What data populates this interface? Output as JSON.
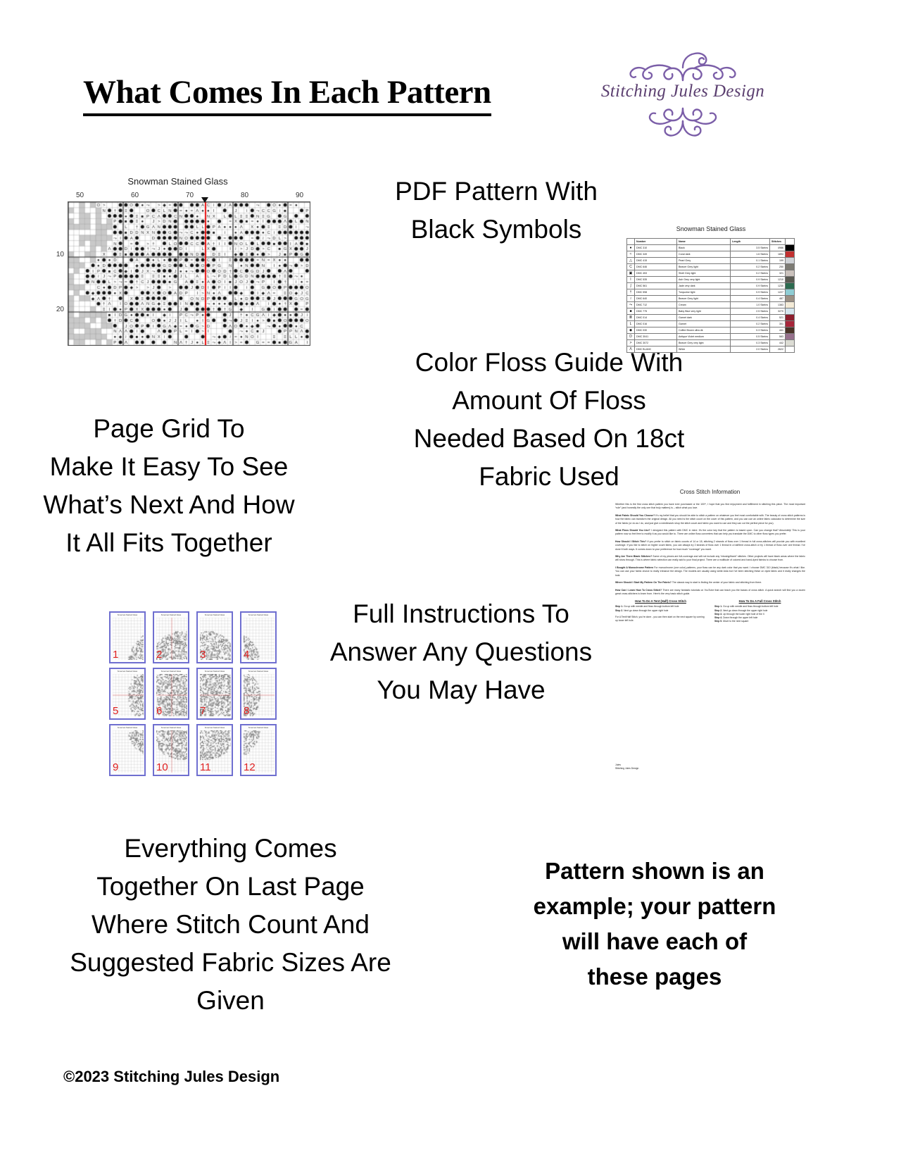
{
  "header": {
    "title": "What Comes In Each Pattern",
    "logo": {
      "brand": "Stitching Jules Design",
      "accent_color": "#7b5ea8",
      "text_color": "#5b3f70",
      "flourish_top_icon": "flourish-ornament-icon",
      "flourish_bottom_icon": "flourish-ornament-icon"
    }
  },
  "captions": {
    "pdf_pattern": "PDF Pattern With\nBlack Symbols",
    "page_grid": "Page Grid To\nMake It Easy To See\nWhat’s Next And How\nIt All Fits Together",
    "color_floss": "Color Floss Guide With\nAmount Of Floss\nNeeded Based On 18ct\nFabric Used",
    "full_instructions": "Full Instructions To\nAnswer Any Questions\nYou May Have",
    "everything_comes": "Everything Comes\nTogether On Last Page\nWhere Stitch Count And\nSuggested Fabric Sizes Are\nGiven",
    "disclaimer": "Pattern shown is an\nexample; your pattern\nwill have each of\nthese pages"
  },
  "footer": {
    "copyright": "©2023 Stitching Jules Design"
  },
  "chart": {
    "title": "Snowman Stained Glass",
    "column_labels": [
      "50",
      "60",
      "70",
      "80",
      "90"
    ],
    "row_labels": [
      "10",
      "20"
    ],
    "center_marker_icon": "center-arrow-icon",
    "center_line_color": "#e81010"
  },
  "floss_guide": {
    "title": "Snowman Stained Glass",
    "columns": [
      "",
      "Number",
      "Name",
      "Length",
      "Stitches",
      ""
    ],
    "rows": [
      {
        "symbol": "●",
        "number": "DMC    310",
        "name": "Black",
        "length": "3.5 Skeins",
        "stitches": "4986",
        "color": "#000000"
      },
      {
        "symbol": "≈",
        "number": "DMC    349",
        "name": "Coral dark",
        "length": "1.6 Skeins",
        "stitches": "1894",
        "color": "#c33030"
      },
      {
        "symbol": "△",
        "number": "DMC    415",
        "name": "Pearl Grey",
        "length": "0.1 Skeins",
        "stitches": "199",
        "color": "#cfd2d6"
      },
      {
        "symbol": "C",
        "number": "DMC    646",
        "name": "Beaver Grey light",
        "length": "0.2 Skeins",
        "stitches": "250",
        "color": "#7d7b74"
      },
      {
        "symbol": "▣",
        "number": "DMC    453",
        "name": "Shell Grey light",
        "length": "0.2 Skeins",
        "stitches": "321",
        "color": "#cbc2bd"
      },
      {
        "symbol": "I",
        "number": "DMC    535",
        "name": "Ash Grey very light",
        "length": "0.9 Skeins",
        "stitches": "1210",
        "color": "#5a5a52"
      },
      {
        "symbol": "∫",
        "number": "DMC    561",
        "name": "Jade very dark",
        "length": "0.9 Skeins",
        "stitches": "1230",
        "color": "#2c6b50"
      },
      {
        "symbol": "†",
        "number": "DMC    598",
        "name": "Turquoise light",
        "length": "0.9 Skeins",
        "stitches": "1227",
        "color": "#8fcdd4"
      },
      {
        "symbol": "≀",
        "number": "DMC    640",
        "name": "Beaver Grey light",
        "length": "0.4 Skeins",
        "stitches": "487",
        "color": "#9b9084"
      },
      {
        "symbol": "⤳",
        "number": "DMC    712",
        "name": "Cream",
        "length": "1.0 Skeins",
        "stitches": "1383",
        "color": "#f3ead6"
      },
      {
        "symbol": "■",
        "number": "DMC    775",
        "name": "Baby Blue very light",
        "length": "2.5 Skeins",
        "stitches": "3270",
        "color": "#d5e6ef"
      },
      {
        "symbol": "≣",
        "number": "DMC    014",
        "name": "Garnet dark",
        "length": "0.4 Skeins",
        "stitches": "521",
        "color": "#8d1f2d"
      },
      {
        "symbol": "L",
        "number": "DMC    016",
        "name": "Garnet",
        "length": "0.2 Skeins",
        "stitches": "301",
        "color": "#a8263a"
      },
      {
        "symbol": "◆",
        "number": "DMC    030",
        "name": "Coffee Brown ultra dk",
        "length": "0.3 Skeins",
        "stitches": "441",
        "color": "#4a3328"
      },
      {
        "symbol": "D",
        "number": "DMC    3041",
        "name": "Antique Violet medium",
        "length": "0.5 Skeins",
        "stitches": "583",
        "color": "#96708c"
      },
      {
        "symbol": ">",
        "number": "DMC    3072",
        "name": "Beaver Grey very light",
        "length": "0.3 Skeins",
        "stitches": "442",
        "color": "#dcdcd4"
      },
      {
        "symbol": "Λ",
        "number": "DMC  BLANC",
        "name": "White",
        "length": "2.0 Skeins",
        "stitches": "2622",
        "color": "#ffffff"
      }
    ]
  },
  "page_grid": {
    "thumbnail_numbers": [
      "1",
      "2",
      "3",
      "4",
      "5",
      "6",
      "7",
      "8",
      "9",
      "10",
      "11",
      "12"
    ],
    "thumbnail_title": "Snowman Stained Glass",
    "border_color": "#6f6fd0",
    "number_color": "#e02020"
  },
  "instructions": {
    "title": "Cross Stitch Information",
    "intro": "Whether this is the first cross stitch pattern you have ever purchased or the 100ᵗʰ, I hope that you find enjoyment and fulfillment in stitching this piece. The most important “rule” (and honestly the only one that truly matters) is – stitch what you love.",
    "sections": [
      {
        "heading": "What Fabric Should You Choose?",
        "body": "It’s my belief that you should be able to stitch a pattern on whatever you feel most comfortable with. The beauty of cross stitch patterns is how the fabric can transform the original design. All you need is the stitch count on the cover of this pattern, and you can use an online fabric calculator to determine the size of the fabric (or do as I do, and just give a needlework shop the stitch count and fabric you want to use and they can cut the perfect piece for you)."
      },
      {
        "heading": "What Floss Should You Use?",
        "body": "I designed this pattern with DMC in mind. It’s the color key that the pattern is based upon. Can you change that? Absolutely! This is your pattern now so feel free to modify it as you would like to. There are online floss converters that can help you translate the DMC to other floss types you prefer."
      },
      {
        "heading": "How Should I Stitch This?",
        "body": "If you prefer to stitch on fabric counts of 14 or 18, stitching 2 strands of floss over 1 thread in full cross-stitches will provide you with excellent coverage. If you like to stitch on higher count fabric, you can always try 2 strands of floss over 1 thread in a half/tent cross-stitch or try 1 thread of floss over one thread. I’ve done it both ways. It comes down to your preference for how much “coverage” you want."
      },
      {
        "heading": "Why Are There Blank Stitches?",
        "body": "Some of my pieces are full-coverage and will not include any “missing/blank” stitches. Other projects will have blank areas where the fabric will show through. This is where fabric selection can really add to your final project. There are a multitude of colored and hand-dyed fabrics to choose from."
      },
      {
        "heading": "I Bought A Monochrome Pattern",
        "body": "For monochrome (one color) patterns, your floss can be any dark color that you want. I choose DMC 310 (black) because it’s what I like. You can use your fabric choice to really enhance the design. The models are usually using white Aida but I’ve been stitching these on dyed fabric and it really changes the look."
      },
      {
        "heading": "Where Should I Start My Pattern On The Fabric?",
        "body": "The classic way to start is finding the center of your fabric and stitching from there."
      },
      {
        "heading": "How Can I Learn How To Cross Stitch?",
        "body": "There are many fantastic tutorials on YouTube that can teach you the basics of cross stitch. A quick search will find you a dozen great cross-stitchers to learn from. Here’s the very basic stitch guide."
      }
    ],
    "tent_stitch": {
      "heading": "How To Do A Tent (Half) Cross Stitch",
      "steps": [
        "Step 1. Go up with needle and floss through bottom left hole",
        "Step 2. Next go down through the upper right hole"
      ],
      "note": "For A Tent/Half Stitch, you’re done - you can then start on the next square by coming up lower left hole."
    },
    "full_stitch": {
      "heading": "How To Do A Full Cross Stitch",
      "steps": [
        "Step 1. Go up with needle and floss through bottom left hole",
        "Step 2. Next go down through the upper right hole",
        "Step 3. Up through the lower right hole of the X",
        "Step 4. Down through the upper left hole",
        "Step 5. Move to the next square"
      ]
    },
    "signature": [
      "Jules",
      "Stitching Jules Design"
    ]
  }
}
